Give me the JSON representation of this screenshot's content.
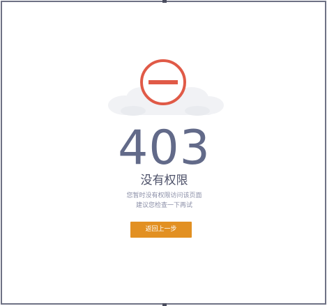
{
  "error": {
    "code": "403",
    "title": "没有权限",
    "message_line1": "您暂时没有权限访问该页面",
    "message_line2": "建议您检查一下再试"
  },
  "actions": {
    "back_label": "返回上一步"
  },
  "icon": "forbidden-icon",
  "colors": {
    "icon_red": "#e05a47",
    "button_orange": "#e29022",
    "code_text": "#626a89",
    "border": "#6e7184"
  }
}
